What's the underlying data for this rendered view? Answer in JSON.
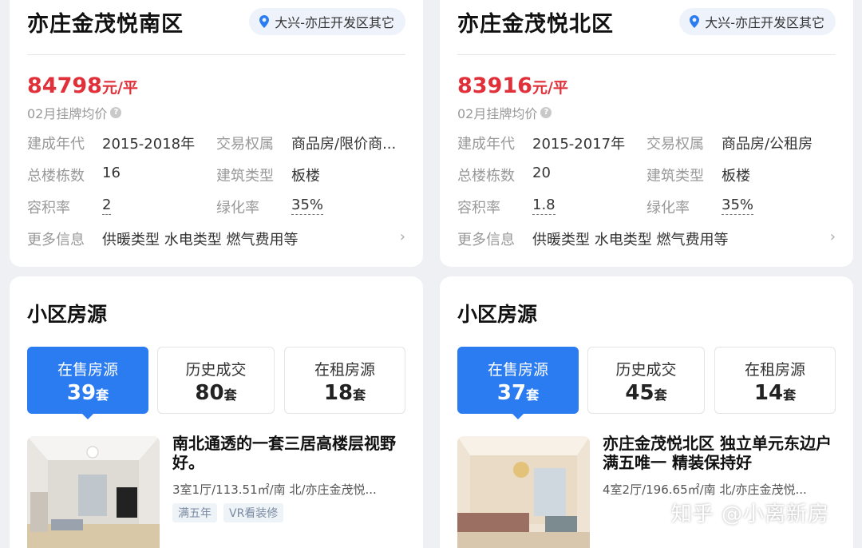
{
  "left": {
    "title": "亦庄金茂悦南区",
    "location": "大兴-亦庄开发区其它",
    "price_num": "84798",
    "price_unit": "元/平",
    "price_note": "02月挂牌均价",
    "attrs": {
      "build_year_label": "建成年代",
      "build_year": "2015-2018年",
      "ownership_label": "交易权属",
      "ownership": "商品房/限价商...",
      "buildings_label": "总楼栋数",
      "buildings": "16",
      "type_label": "建筑类型",
      "type": "板楼",
      "far_label": "容积率",
      "far": "2",
      "green_label": "绿化率",
      "green": "35%",
      "more_label": "更多信息",
      "more": "供暖类型 水电类型 燃气费用等"
    },
    "section_title": "小区房源",
    "tabs": [
      {
        "label": "在售房源",
        "count": "39",
        "unit": "套"
      },
      {
        "label": "历史成交",
        "count": "80",
        "unit": "套"
      },
      {
        "label": "在租房源",
        "count": "18",
        "unit": "套"
      }
    ],
    "listing": {
      "title": "南北通透的一套三居高楼层视野好。",
      "meta": "3室1厅/113.51㎡/南 北/亦庄金茂悦...",
      "tags": [
        "满五年",
        "VR看装修"
      ]
    }
  },
  "right": {
    "title": "亦庄金茂悦北区",
    "location": "大兴-亦庄开发区其它",
    "price_num": "83916",
    "price_unit": "元/平",
    "price_note": "02月挂牌均价",
    "attrs": {
      "build_year_label": "建成年代",
      "build_year": "2015-2017年",
      "ownership_label": "交易权属",
      "ownership": "商品房/公租房",
      "buildings_label": "总楼栋数",
      "buildings": "20",
      "type_label": "建筑类型",
      "type": "板楼",
      "far_label": "容积率",
      "far": "1.8",
      "green_label": "绿化率",
      "green": "35%",
      "more_label": "更多信息",
      "more": "供暖类型 水电类型 燃气费用等"
    },
    "section_title": "小区房源",
    "tabs": [
      {
        "label": "在售房源",
        "count": "37",
        "unit": "套"
      },
      {
        "label": "历史成交",
        "count": "45",
        "unit": "套"
      },
      {
        "label": "在租房源",
        "count": "14",
        "unit": "套"
      }
    ],
    "listing": {
      "title": "亦庄金茂悦北区 独立单元东边户 满五唯一 精装保持好",
      "meta": "4室2厅/196.65㎡/南 北/亦庄金茂悦..."
    }
  },
  "watermark": "知乎 @小离新房",
  "colors": {
    "accent": "#2b7cf0",
    "price": "#e0313b"
  }
}
